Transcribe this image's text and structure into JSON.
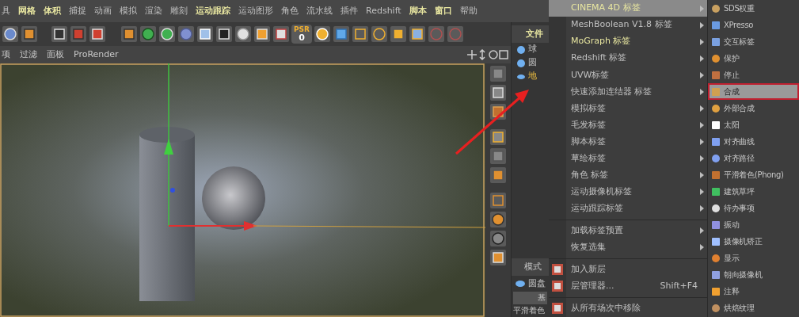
{
  "menubar": [
    {
      "label": "具",
      "accent": false
    },
    {
      "label": "网格",
      "accent": true
    },
    {
      "label": "体积",
      "accent": true
    },
    {
      "label": "捕捉",
      "accent": false
    },
    {
      "label": "动画",
      "accent": false
    },
    {
      "label": "模拟",
      "accent": false
    },
    {
      "label": "渲染",
      "accent": false
    },
    {
      "label": "雕刻",
      "accent": false
    },
    {
      "label": "运动跟踪",
      "accent": true
    },
    {
      "label": "运动图形",
      "accent": false
    },
    {
      "label": "角色",
      "accent": false
    },
    {
      "label": "流水线",
      "accent": false
    },
    {
      "label": "插件",
      "accent": false
    },
    {
      "label": "Redshift",
      "accent": false
    },
    {
      "label": "脚本",
      "accent": true
    },
    {
      "label": "窗口",
      "accent": true
    },
    {
      "label": "帮助",
      "accent": false
    }
  ],
  "toolbar": {
    "psr_label": "PSR",
    "psr_value": "0"
  },
  "viewport_menu": [
    "项",
    "过滤",
    "面板",
    "ProRender"
  ],
  "object_manager": {
    "tab": "文件",
    "objects": [
      {
        "name": "球",
        "selected": false
      },
      {
        "name": "圆",
        "selected": false
      },
      {
        "name": "地",
        "selected": true
      }
    ]
  },
  "attributes": {
    "tab": "模式",
    "object": "圆盘",
    "section": "基",
    "field": "平滑着色"
  },
  "tag_menu": {
    "items": [
      {
        "kind": "item",
        "label": "CINEMA 4D 标签",
        "selected": true,
        "accent": true,
        "submenu": true
      },
      {
        "kind": "item",
        "label": "MeshBoolean V1.8 标签",
        "selected": false,
        "accent": false,
        "submenu": true
      },
      {
        "kind": "item",
        "label": "MoGraph 标签",
        "selected": false,
        "accent": true,
        "submenu": true
      },
      {
        "kind": "item",
        "label": "Redshift 标签",
        "selected": false,
        "accent": false,
        "submenu": true
      },
      {
        "kind": "item",
        "label": "UVW标签",
        "selected": false,
        "accent": false,
        "submenu": true
      },
      {
        "kind": "item",
        "label": "快速添加连结器 标签",
        "selected": false,
        "accent": false,
        "submenu": true
      },
      {
        "kind": "item",
        "label": "模拟标签",
        "selected": false,
        "accent": false,
        "submenu": true
      },
      {
        "kind": "item",
        "label": "毛发标签",
        "selected": false,
        "accent": false,
        "submenu": true
      },
      {
        "kind": "item",
        "label": "脚本标签",
        "selected": false,
        "accent": false,
        "submenu": true
      },
      {
        "kind": "item",
        "label": "草绘标签",
        "selected": false,
        "accent": false,
        "submenu": true
      },
      {
        "kind": "item",
        "label": "角色 标签",
        "selected": false,
        "accent": false,
        "submenu": true
      },
      {
        "kind": "item",
        "label": "运动摄像机标签",
        "selected": false,
        "accent": false,
        "submenu": true
      },
      {
        "kind": "item",
        "label": "运动跟踪标签",
        "selected": false,
        "accent": false,
        "submenu": true
      },
      {
        "kind": "separator"
      },
      {
        "kind": "item",
        "label": "加载标签预置",
        "selected": false,
        "accent": false,
        "submenu": true
      },
      {
        "kind": "item",
        "label": "恢复选集",
        "selected": false,
        "accent": false,
        "submenu": true
      },
      {
        "kind": "separator"
      },
      {
        "kind": "layer",
        "label": "加入新层",
        "selected": false,
        "accent": false,
        "submenu": false
      },
      {
        "kind": "layer",
        "label": "层管理器...",
        "shortcut": "Shift+F4",
        "selected": false,
        "accent": false,
        "submenu": false
      },
      {
        "kind": "separator"
      },
      {
        "kind": "layer",
        "label": "从所有场次中移除",
        "selected": false,
        "accent": false,
        "submenu": false
      }
    ]
  },
  "tag_submenu": [
    {
      "label": "SDS权重",
      "selected": false
    },
    {
      "label": "XPresso",
      "selected": false
    },
    {
      "label": "交互标签",
      "selected": false
    },
    {
      "label": "保护",
      "selected": false
    },
    {
      "label": "停止",
      "selected": false
    },
    {
      "label": "合成",
      "selected": true
    },
    {
      "label": "外部合成",
      "selected": false
    },
    {
      "label": "太阳",
      "selected": false
    },
    {
      "label": "对齐曲线",
      "selected": false
    },
    {
      "label": "对齐路径",
      "selected": false
    },
    {
      "label": "平滑着色(Phong)",
      "selected": false
    },
    {
      "label": "建筑草坪",
      "selected": false
    },
    {
      "label": "待办事项",
      "selected": false
    },
    {
      "label": "振动",
      "selected": false
    },
    {
      "label": "摄像机矫正",
      "selected": false
    },
    {
      "label": "显示",
      "selected": false
    },
    {
      "label": "朝向摄像机",
      "selected": false
    },
    {
      "label": "注释",
      "selected": false
    },
    {
      "label": "烘焙纹理",
      "selected": false
    }
  ]
}
